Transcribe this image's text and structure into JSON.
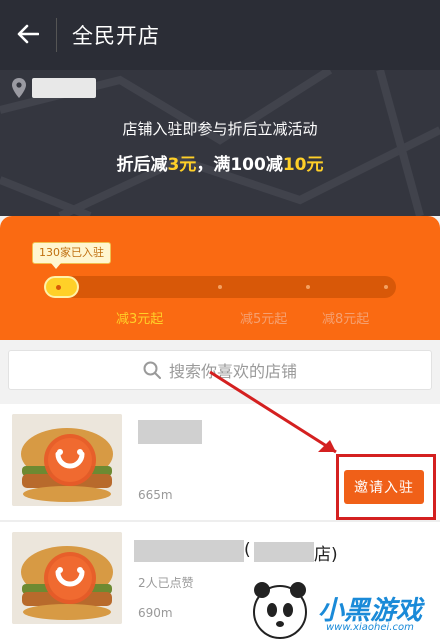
{
  "appbar": {
    "title": "全民开店"
  },
  "banner": {
    "line1": "店铺入驻即参与折后立减活动",
    "line2_prefix": "折后减",
    "line2_v1": "3元",
    "line2_mid": "，满100减",
    "line2_v2": "10元"
  },
  "progress": {
    "tooltip": "130家已入驻",
    "fill_fraction": 0.1,
    "tiers": [
      "减3元起",
      "减5元起",
      "减8元起"
    ],
    "active_color": "#ffd028",
    "bar_color": "#fa6a12"
  },
  "search": {
    "placeholder": "搜索你喜欢的店铺"
  },
  "stores": [
    {
      "distance": "665m",
      "button": "邀请入驻"
    },
    {
      "suffix_open": "(",
      "suffix_close": "店)",
      "likes": "2人已点赞",
      "distance": "690m"
    }
  ],
  "watermark": {
    "brand": "小黑游戏",
    "url": "www.xiaohei.com"
  }
}
